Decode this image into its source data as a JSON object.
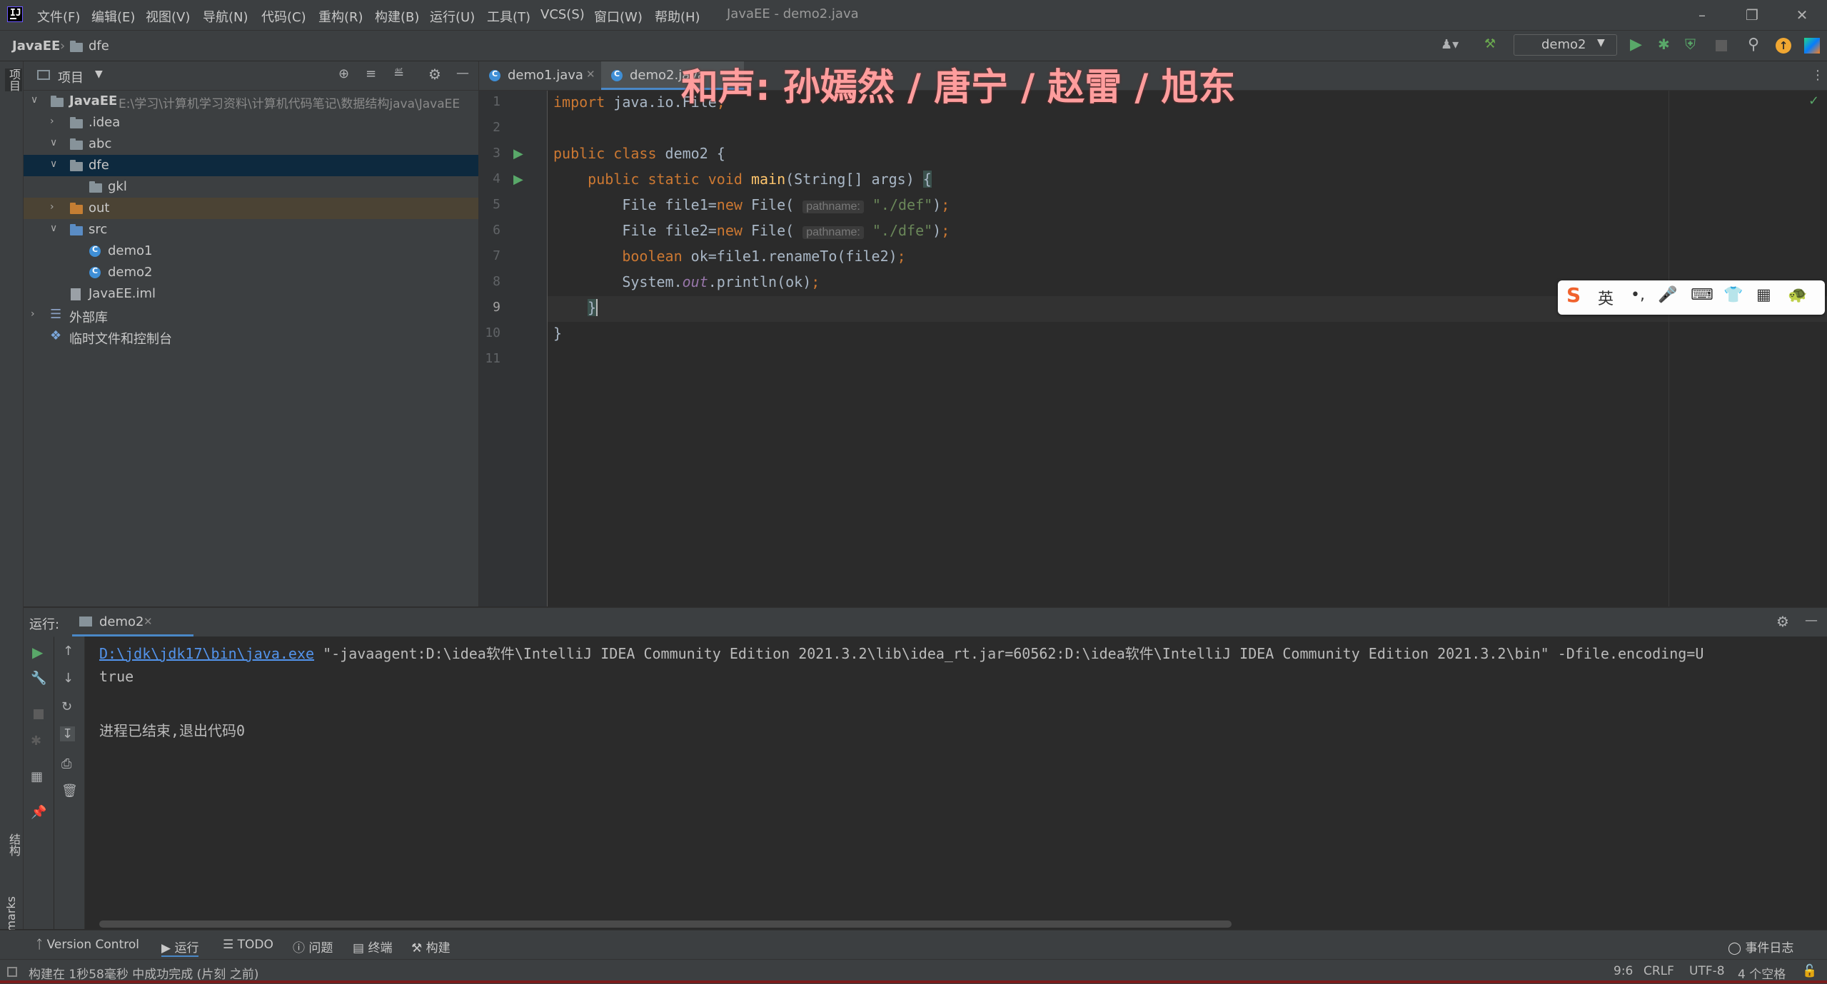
{
  "title_bar": {
    "window_title": "JavaEE - demo2.java",
    "menus": [
      "文件(F)",
      "编辑(E)",
      "视图(V)",
      "导航(N)",
      "代码(C)",
      "重构(R)",
      "构建(B)",
      "运行(U)",
      "工具(T)",
      "VCS(S)",
      "窗口(W)",
      "帮助(H)"
    ]
  },
  "nav_bar": {
    "breadcrumb_project": "JavaEE",
    "breadcrumb_folder": "dfe",
    "run_config": "demo2"
  },
  "left_strip": {
    "project_label": "项目",
    "structure_label": "结构",
    "bookmarks_label": "Bookmarks"
  },
  "project_panel": {
    "header_label": "项目",
    "tree": [
      {
        "label": "JavaEE",
        "path": "E:\\学习\\计算机学习资料\\计算机代码笔记\\数据结构java\\JavaEE"
      },
      {
        "label": ".idea"
      },
      {
        "label": "abc"
      },
      {
        "label": "dfe"
      },
      {
        "label": "gkl"
      },
      {
        "label": "out"
      },
      {
        "label": "src"
      },
      {
        "label": "demo1"
      },
      {
        "label": "demo2"
      },
      {
        "label": "JavaEE.iml"
      },
      {
        "label": "外部库"
      },
      {
        "label": "临时文件和控制台"
      }
    ]
  },
  "editor": {
    "tabs": [
      {
        "label": "demo1.java"
      },
      {
        "label": "demo2.java"
      }
    ],
    "line_numbers": [
      "1",
      "2",
      "3",
      "4",
      "5",
      "6",
      "7",
      "8",
      "9",
      "10",
      "11"
    ],
    "param_hint": "pathname:"
  },
  "run_panel": {
    "label": "运行:",
    "tab": "demo2",
    "console_link": "D:\\jdk\\jdk17\\bin\\java.exe",
    "console_cmd": " \"-javaagent:D:\\idea软件\\IntelliJ IDEA Community Edition 2021.3.2\\lib\\idea_rt.jar=60562:D:\\idea软件\\IntelliJ IDEA Community Edition 2021.3.2\\bin\" -Dfile.encoding=U",
    "console_out": "true",
    "console_exit": "进程已结束,退出代码0"
  },
  "bottom_bar": {
    "items": [
      "Version Control",
      "运行",
      "TODO",
      "问题",
      "终端",
      "构建"
    ],
    "event_log": "事件日志"
  },
  "status_bar": {
    "message": "构建在 1秒58毫秒 中成功完成 (片刻 之前)",
    "position": "9:6",
    "line_sep": "CRLF",
    "encoding": "UTF-8",
    "indent": "4 个空格"
  },
  "overlay": {
    "text": "和声: 孙嫣然 / 唐宁 / 赵雷 / 旭东"
  },
  "ime": {
    "lang": "英"
  },
  "colors": {
    "accent": "#3f8fd6",
    "keyword": "#cc7832",
    "string": "#6a8759",
    "selection": "#0d293e"
  }
}
